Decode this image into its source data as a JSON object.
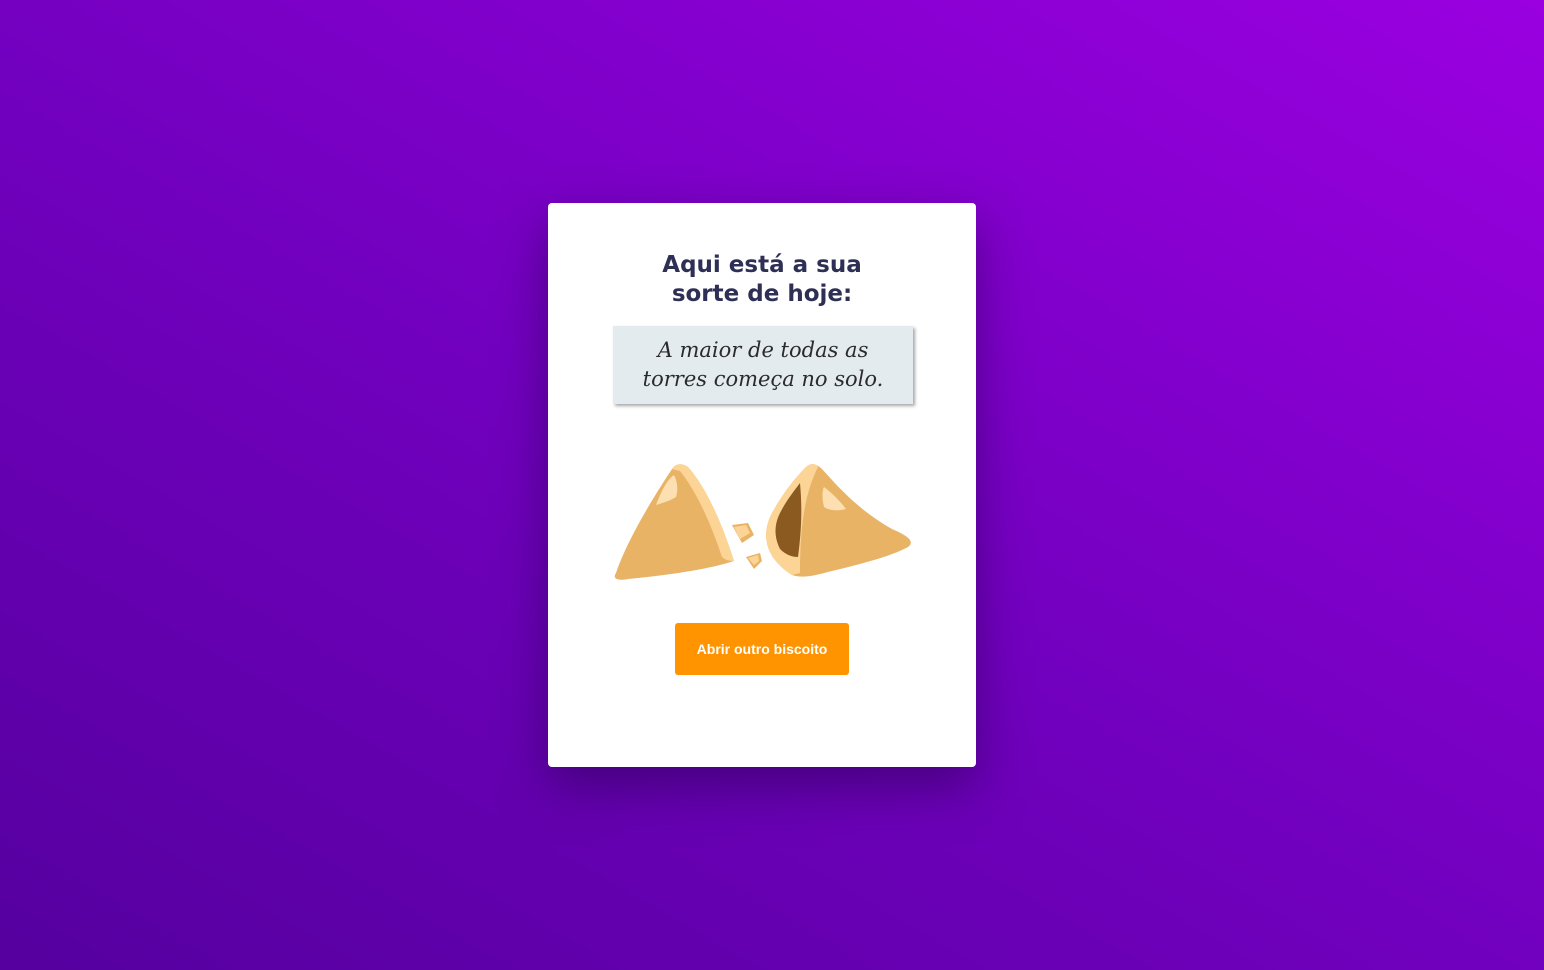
{
  "card": {
    "title": "Aqui está a sua sorte de hoje:",
    "fortune": "A maior de todas as torres começa no solo.",
    "button_label": "Abrir outro biscoito",
    "illustration": "broken-fortune-cookie-icon"
  },
  "colors": {
    "background_start": "#55009f",
    "background_end": "#9a00e0",
    "card": "#ffffff",
    "title": "#2e2f55",
    "fortune_box": "#e3ebef",
    "button": "#ff9400",
    "cookie": "#e9b366"
  }
}
